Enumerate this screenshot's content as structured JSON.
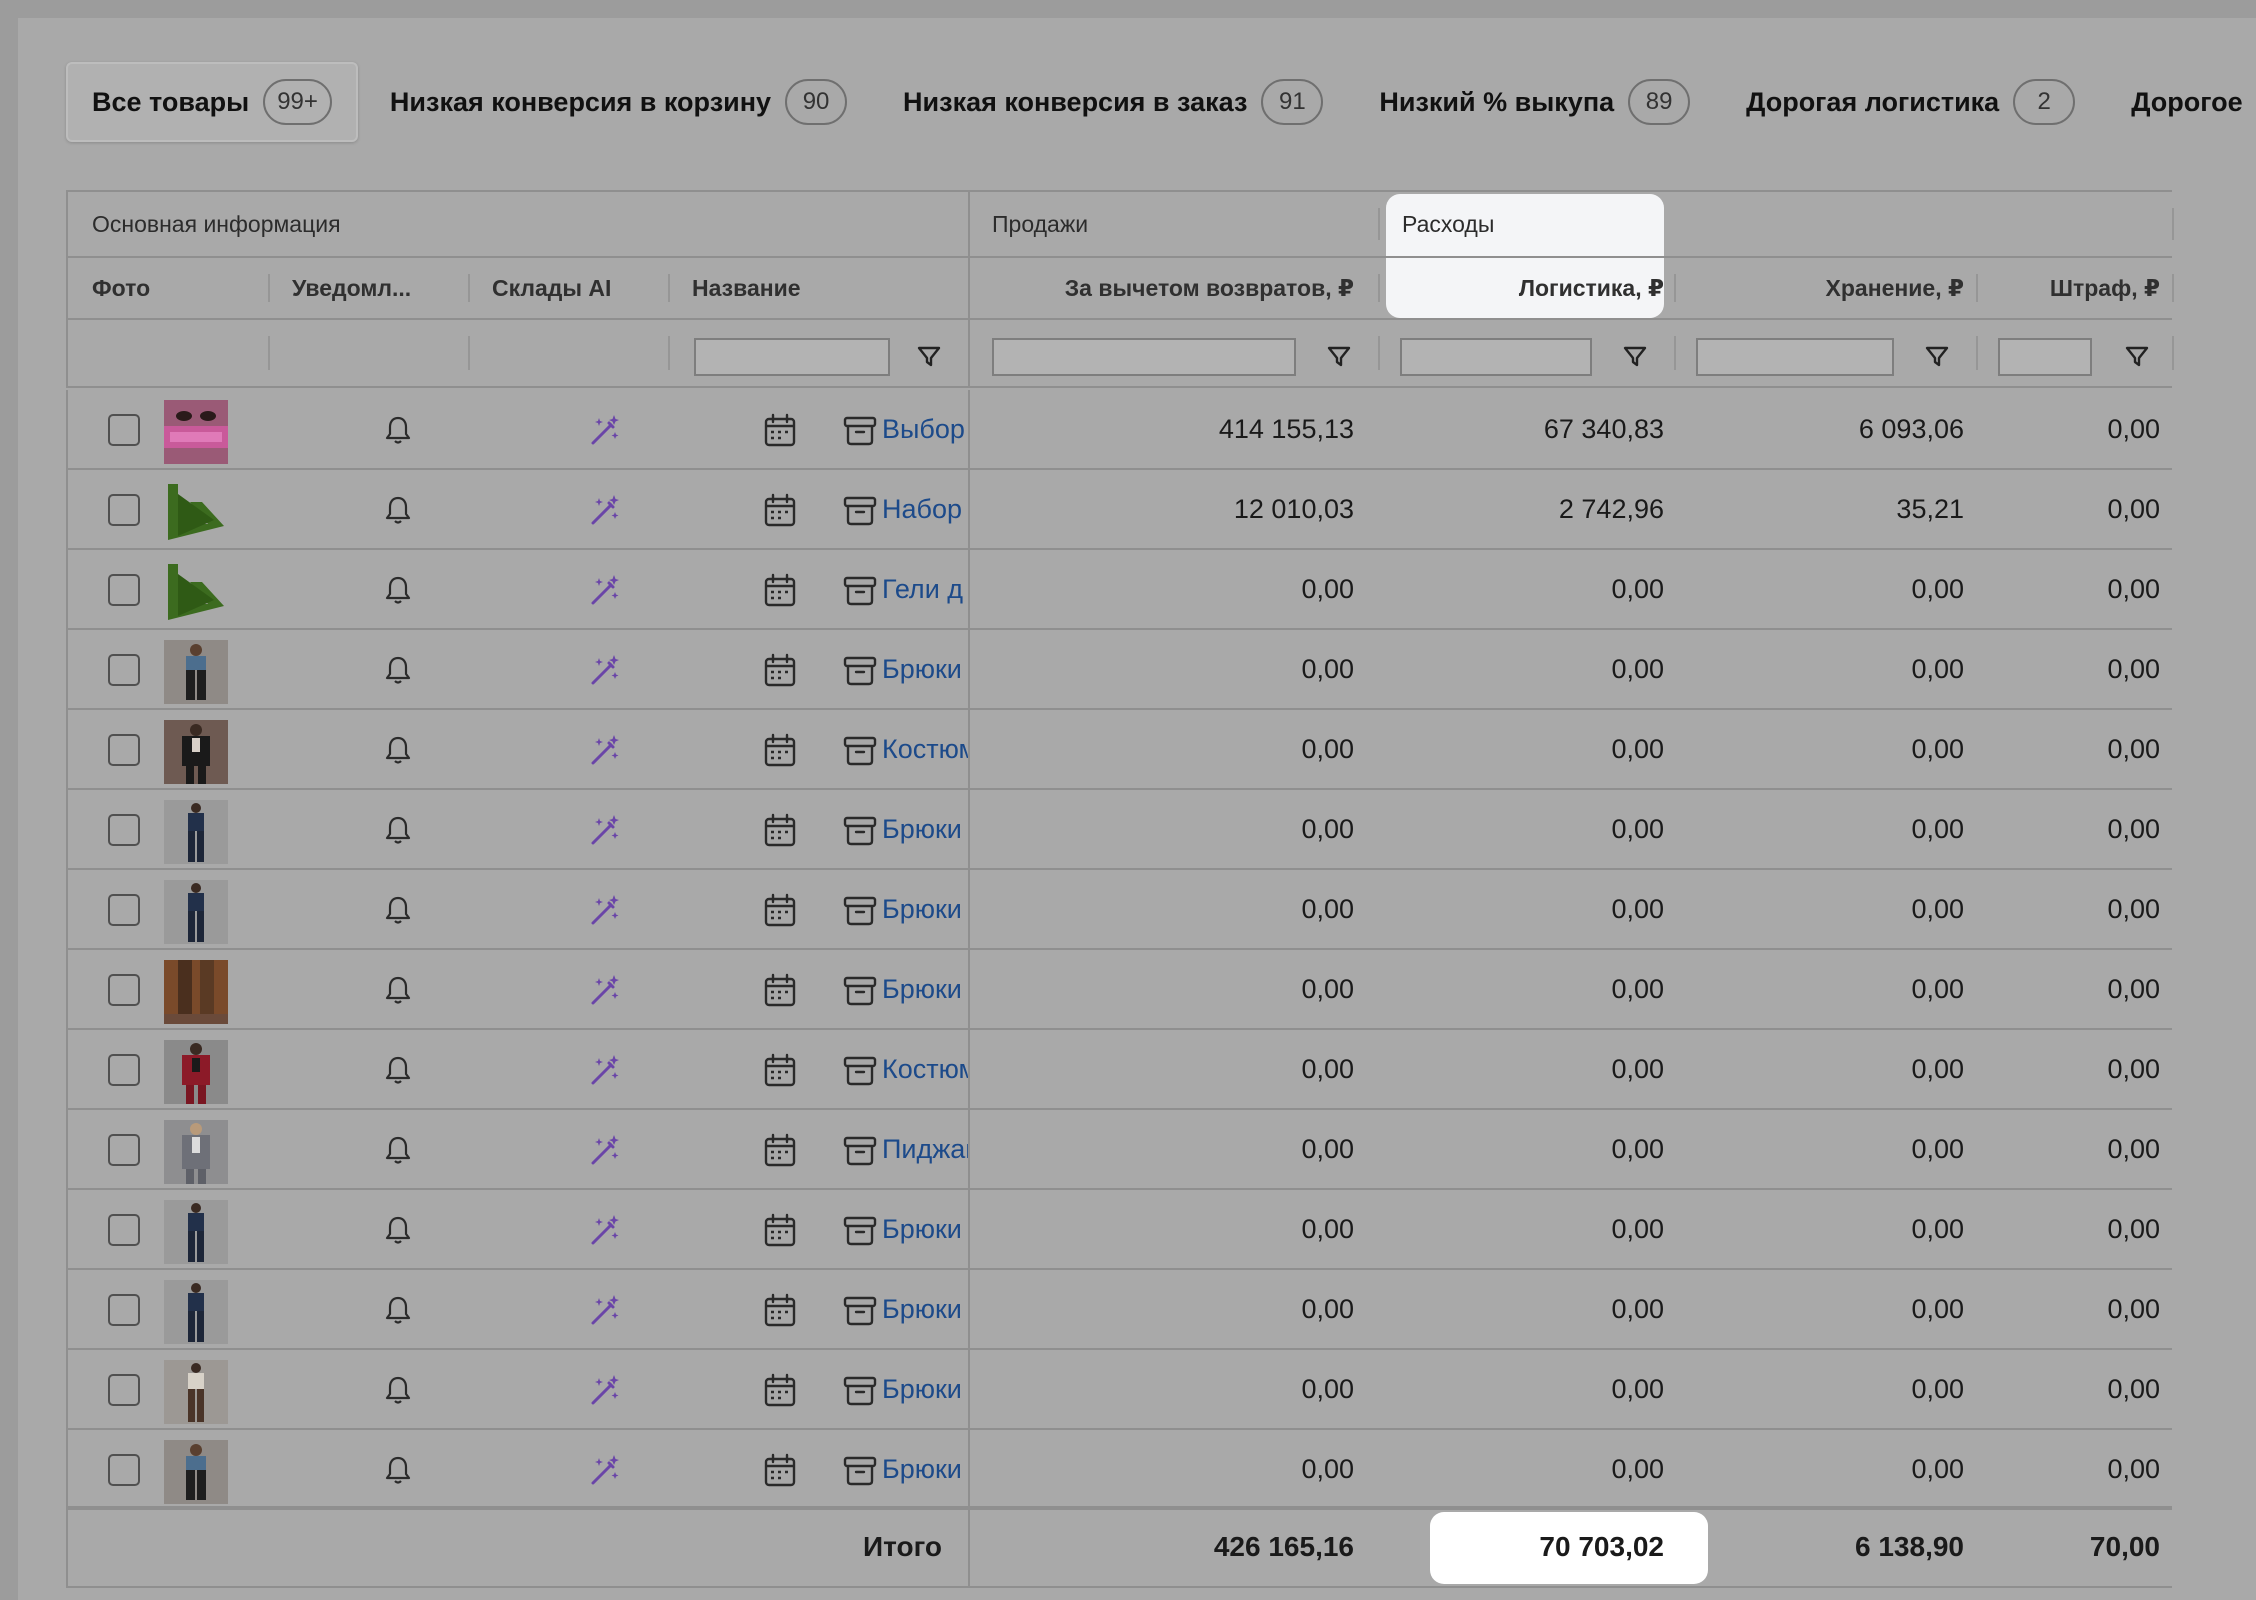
{
  "tabs": [
    {
      "label": "Все товары",
      "count": "99+"
    },
    {
      "label": "Низкая конверсия в корзину",
      "count": "90"
    },
    {
      "label": "Низкая конверсия в заказ",
      "count": "91"
    },
    {
      "label": "Низкий % выкупа",
      "count": "89"
    },
    {
      "label": "Дорогая логистика",
      "count": "2"
    },
    {
      "label": "Дорогое",
      "count": ""
    }
  ],
  "groups": {
    "main": "Основная информация",
    "sales": "Продажи",
    "expenses": "Расходы"
  },
  "columns": {
    "photo": "Фото",
    "notify": "Уведомл...",
    "warehouses": "Склады AI",
    "name": "Название",
    "net_sales": "За вычетом возвратов, ₽",
    "logistics": "Логистика, ₽",
    "storage": "Хранение, ₽",
    "fine": "Штраф, ₽"
  },
  "rows": [
    {
      "thumb": "pink-product",
      "name": "Выбор",
      "net_sales": "414 155,13",
      "logistics": "67 340,83",
      "storage": "6 093,06",
      "fine": "0,00"
    },
    {
      "thumb": "green-logo",
      "name": "Набор",
      "net_sales": "12 010,03",
      "logistics": "2 742,96",
      "storage": "35,21",
      "fine": "0,00"
    },
    {
      "thumb": "green-logo",
      "name": "Гели д",
      "net_sales": "0,00",
      "logistics": "0,00",
      "storage": "0,00",
      "fine": "0,00"
    },
    {
      "thumb": "person-blue-top",
      "name": "Брюки",
      "net_sales": "0,00",
      "logistics": "0,00",
      "storage": "0,00",
      "fine": "0,00"
    },
    {
      "thumb": "person-black-suit",
      "name": "Костюм",
      "net_sales": "0,00",
      "logistics": "0,00",
      "storage": "0,00",
      "fine": "0,00"
    },
    {
      "thumb": "person-navy",
      "name": "Брюки",
      "net_sales": "0,00",
      "logistics": "0,00",
      "storage": "0,00",
      "fine": "0,00"
    },
    {
      "thumb": "person-navy",
      "name": "Брюки",
      "net_sales": "0,00",
      "logistics": "0,00",
      "storage": "0,00",
      "fine": "0,00"
    },
    {
      "thumb": "brown-legs",
      "name": "Брюки",
      "net_sales": "0,00",
      "logistics": "0,00",
      "storage": "0,00",
      "fine": "0,00"
    },
    {
      "thumb": "person-red-suit",
      "name": "Костюм",
      "net_sales": "0,00",
      "logistics": "0,00",
      "storage": "0,00",
      "fine": "0,00"
    },
    {
      "thumb": "person-grey-blazer",
      "name": "Пиджак",
      "net_sales": "0,00",
      "logistics": "0,00",
      "storage": "0,00",
      "fine": "0,00"
    },
    {
      "thumb": "person-navy",
      "name": "Брюки",
      "net_sales": "0,00",
      "logistics": "0,00",
      "storage": "0,00",
      "fine": "0,00"
    },
    {
      "thumb": "person-navy",
      "name": "Брюки",
      "net_sales": "0,00",
      "logistics": "0,00",
      "storage": "0,00",
      "fine": "0,00"
    },
    {
      "thumb": "person-brown-pants",
      "name": "Брюки",
      "net_sales": "0,00",
      "logistics": "0,00",
      "storage": "0,00",
      "fine": "0,00"
    },
    {
      "thumb": "person-blue-top",
      "name": "Брюки",
      "net_sales": "0,00",
      "logistics": "0,00",
      "storage": "0,00",
      "fine": "0,00"
    }
  ],
  "totals": {
    "label": "Итого",
    "net_sales": "426 165,16",
    "logistics": "70 703,02",
    "storage": "6 138,90",
    "fine": "70,00"
  },
  "colors": {
    "link": "#1c4a8a",
    "ai_icon": "#6a45a8",
    "highlight": "#ffffff",
    "dim_overlay": "#a9a9a9"
  }
}
